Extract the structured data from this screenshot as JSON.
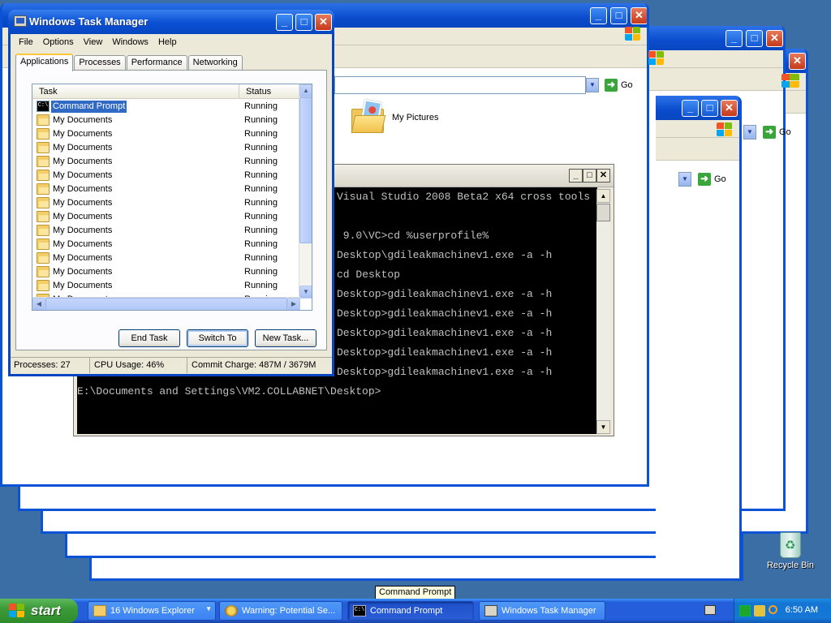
{
  "explorer": {
    "go_label": "Go",
    "my_pictures_label": "My Pictures"
  },
  "cmd": {
    "lines": [
      "Visual Studio 2008 Beta2 x64 cross tools",
      "",
      " 9.0\\VC>cd %userprofile%",
      "Desktop\\gdileakmachinev1.exe -a -h",
      "cd Desktop",
      "Desktop>gdileakmachinev1.exe -a -h",
      "Desktop>gdileakmachinev1.exe -a -h",
      "Desktop>gdileakmachinev1.exe -a -h",
      "Desktop>gdileakmachinev1.exe -a -h",
      "Desktop>gdileakmachinev1.exe -a -h",
      "E:\\Documents and Settings\\VM2.COLLABNET\\Desktop>"
    ]
  },
  "taskmgr": {
    "title": "Windows Task Manager",
    "menu": [
      "File",
      "Options",
      "View",
      "Windows",
      "Help"
    ],
    "tabs": [
      "Applications",
      "Processes",
      "Performance",
      "Networking"
    ],
    "columns": {
      "task": "Task",
      "status": "Status"
    },
    "rows": [
      {
        "name": "Command Prompt",
        "status": "Running",
        "icon": "cmd"
      },
      {
        "name": "My Documents",
        "status": "Running",
        "icon": "folder"
      },
      {
        "name": "My Documents",
        "status": "Running",
        "icon": "folder"
      },
      {
        "name": "My Documents",
        "status": "Running",
        "icon": "folder"
      },
      {
        "name": "My Documents",
        "status": "Running",
        "icon": "folder"
      },
      {
        "name": "My Documents",
        "status": "Running",
        "icon": "folder"
      },
      {
        "name": "My Documents",
        "status": "Running",
        "icon": "folder"
      },
      {
        "name": "My Documents",
        "status": "Running",
        "icon": "folder"
      },
      {
        "name": "My Documents",
        "status": "Running",
        "icon": "folder"
      },
      {
        "name": "My Documents",
        "status": "Running",
        "icon": "folder"
      },
      {
        "name": "My Documents",
        "status": "Running",
        "icon": "folder"
      },
      {
        "name": "My Documents",
        "status": "Running",
        "icon": "folder"
      },
      {
        "name": "My Documents",
        "status": "Running",
        "icon": "folder"
      },
      {
        "name": "My Documents",
        "status": "Running",
        "icon": "folder"
      },
      {
        "name": "My Documents",
        "status": "Running",
        "icon": "folder"
      }
    ],
    "buttons": {
      "end_task": "End Task",
      "switch_to": "Switch To",
      "new_task": "New Task..."
    },
    "status": {
      "processes": "Processes: 27",
      "cpu": "CPU Usage: 46%",
      "commit": "Commit Charge: 487M / 3679M"
    }
  },
  "desktop": {
    "recycle_bin_label": "Recycle Bin",
    "tooltip": "Command Prompt"
  },
  "taskbar": {
    "start_label": "start",
    "buttons": [
      {
        "label": "16 Windows Explorer",
        "icon": "folder-icon"
      },
      {
        "label": "Warning: Potential Se...",
        "icon": "warning-icon"
      },
      {
        "label": "Command Prompt",
        "icon": "cmd-icon"
      },
      {
        "label": "Windows Task Manager",
        "icon": "task-manager-icon"
      }
    ],
    "clock": "6:50 AM"
  }
}
